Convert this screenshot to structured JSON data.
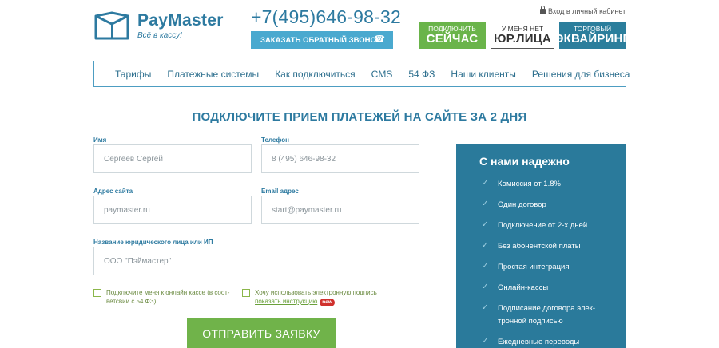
{
  "header": {
    "logo_name": "PayMaster",
    "logo_tagline": "Всё в кассу!",
    "phone": "+7(495)646-98-32",
    "callback_label": "ЗАКАЗАТЬ ОБРАТНЫЙ ЗВОНОК",
    "cabinet_label": "Вход в личный кабинет",
    "promos": [
      {
        "small": "ПОДКЛЮЧИТЬ",
        "big": "СЕЙЧАС",
        "color": "#6ab44a"
      },
      {
        "small": "У МЕНЯ НЕТ",
        "big": "ЮР.ЛИЦА",
        "color": "#ffffff"
      },
      {
        "small": "ТОРГОВЫЙ",
        "big": "ЭКВАЙРИНГ",
        "color": "#2b7e9c"
      }
    ]
  },
  "nav": {
    "items": [
      "Тарифы",
      "Платежные системы",
      "Как подключиться",
      "CMS",
      "54 ФЗ",
      "Наши клиенты",
      "Решения для бизнеса"
    ]
  },
  "form": {
    "title": "ПОДКЛЮЧИТЕ ПРИЕМ ПЛАТЕЖЕЙ НА САЙТЕ ЗА 2 ДНЯ",
    "name_label": "Имя",
    "name_placeholder": "Сергеев Сергей",
    "phone_label": "Телефон",
    "phone_placeholder": "8 (495) 646-98-32",
    "site_label": "Адрес сайта",
    "site_placeholder": "paymaster.ru",
    "email_label": "Email адрес",
    "email_placeholder": "start@paymaster.ru",
    "company_label": "Название юридического лица или ИП",
    "company_placeholder": "ООО \"Пэймастер\"",
    "check1_text": "Подключите меня к онлайн кассе (в соот-ветсвии с 54 ФЗ)",
    "check2_text": "Хочу использовать электронную подпись",
    "check2_link": "показать инструкцию",
    "check2_badge": "new",
    "submit_label": "ОТПРАВИТЬ ЗАЯВКУ"
  },
  "panel": {
    "title": "С нами надежно",
    "items": [
      "Комиссия от 1.8%",
      "Один договор",
      "Подключение от 2-х дней",
      "Без абонентской платы",
      "Простая интеграция",
      "Онлайн-кассы",
      "Подписание договора элек-тронной подписью",
      "Ежедневные переводы"
    ]
  },
  "colors": {
    "brand_blue": "#2d7aa0",
    "accent_green": "#70b34a",
    "panel_bg": "#2a7a9b"
  }
}
